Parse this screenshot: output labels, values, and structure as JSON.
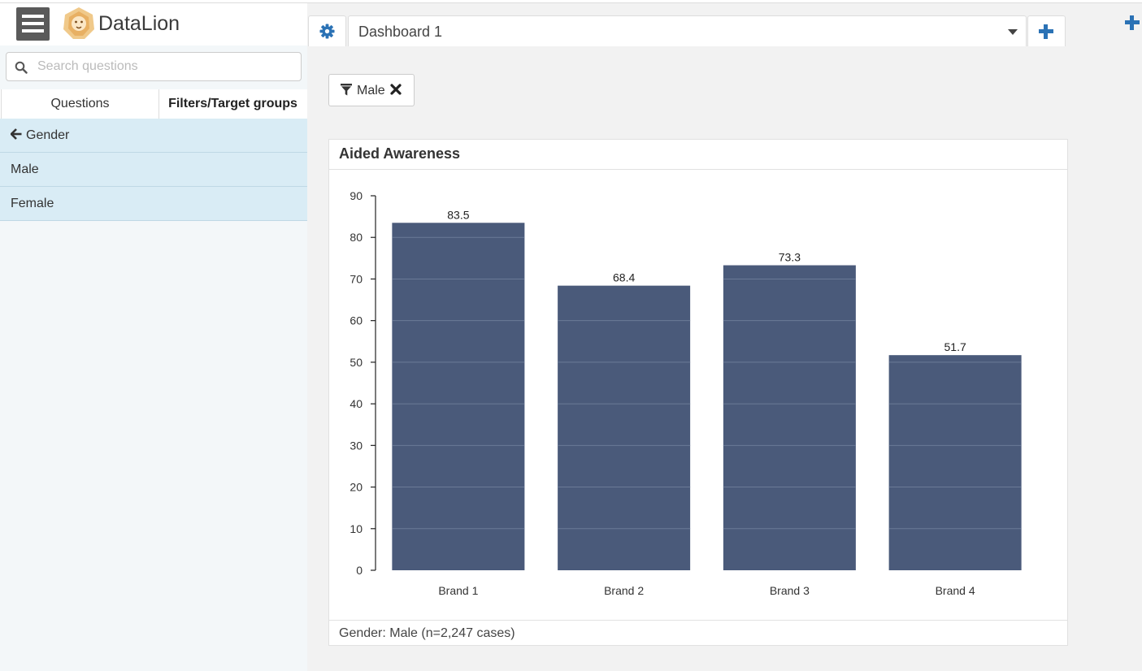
{
  "app": {
    "name": "DataLion"
  },
  "search": {
    "placeholder": "Search questions"
  },
  "sidebar": {
    "tabs": [
      {
        "label": "Questions"
      },
      {
        "label": "Filters/Target groups"
      }
    ],
    "back_item": {
      "label": "Gender"
    },
    "items": [
      {
        "label": "Male"
      },
      {
        "label": "Female"
      }
    ]
  },
  "dashboard": {
    "selected": "Dashboard 1"
  },
  "filter_chip": {
    "label": "Male"
  },
  "card": {
    "title": "Aided Awareness",
    "footer": "Gender: Male (n=2,247 cases)"
  },
  "colors": {
    "bar": "#4a5a7a",
    "accent": "#2b72b5",
    "sidebar_item": "#d9ecf5"
  },
  "chart_data": {
    "type": "bar",
    "categories": [
      "Brand 1",
      "Brand 2",
      "Brand 3",
      "Brand 4"
    ],
    "values": [
      83.5,
      68.4,
      73.3,
      51.7
    ],
    "data_labels": [
      "83.5",
      "68.4",
      "73.3",
      "51.7"
    ],
    "title": "Aided Awareness",
    "xlabel": "",
    "ylabel": "",
    "ylim": [
      0,
      90
    ],
    "yticks": [
      0,
      10,
      20,
      30,
      40,
      50,
      60,
      70,
      80,
      90
    ],
    "grid": true,
    "legend": "none"
  }
}
